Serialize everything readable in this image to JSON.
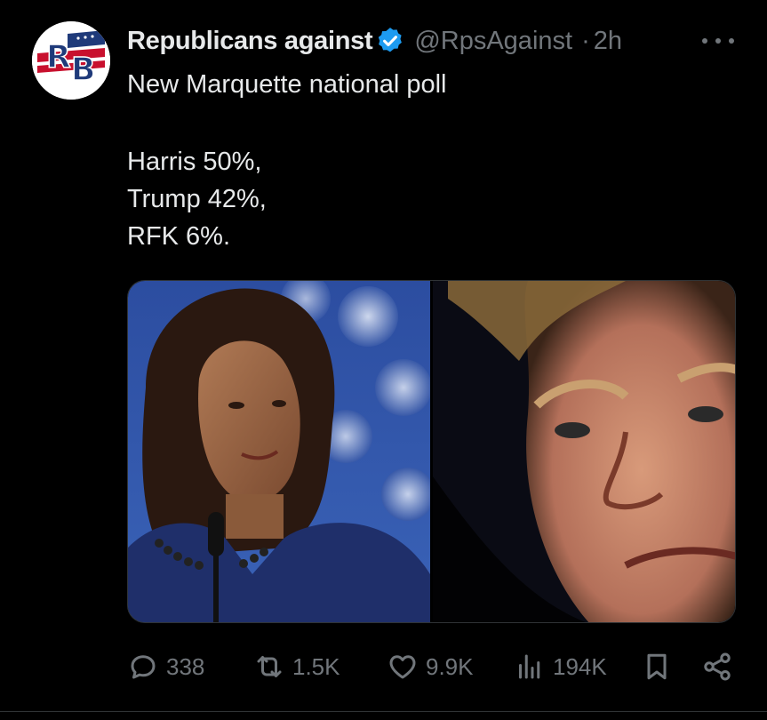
{
  "author": {
    "display_name": "Republicans against",
    "handle": "@RpsAgainst",
    "time": "2h",
    "separator": "·",
    "avatar_letters": "RB",
    "verified": true
  },
  "post": {
    "lines": [
      "New Marquette national poll",
      "Harris 50%,",
      "Trump 42%,",
      "RFK 6%."
    ]
  },
  "media": {
    "panels": 2
  },
  "actions": {
    "replies": "338",
    "reposts": "1.5K",
    "likes": "9.9K",
    "views": "194K"
  },
  "colors": {
    "background": "#000000",
    "text_primary": "#e7e9ea",
    "text_secondary": "#71767b",
    "verified_blue": "#1d9bf0"
  },
  "icons": [
    "reply-icon",
    "repost-icon",
    "like-icon",
    "views-icon",
    "bookmark-icon",
    "share-icon",
    "more-icon",
    "verified-badge-icon"
  ]
}
